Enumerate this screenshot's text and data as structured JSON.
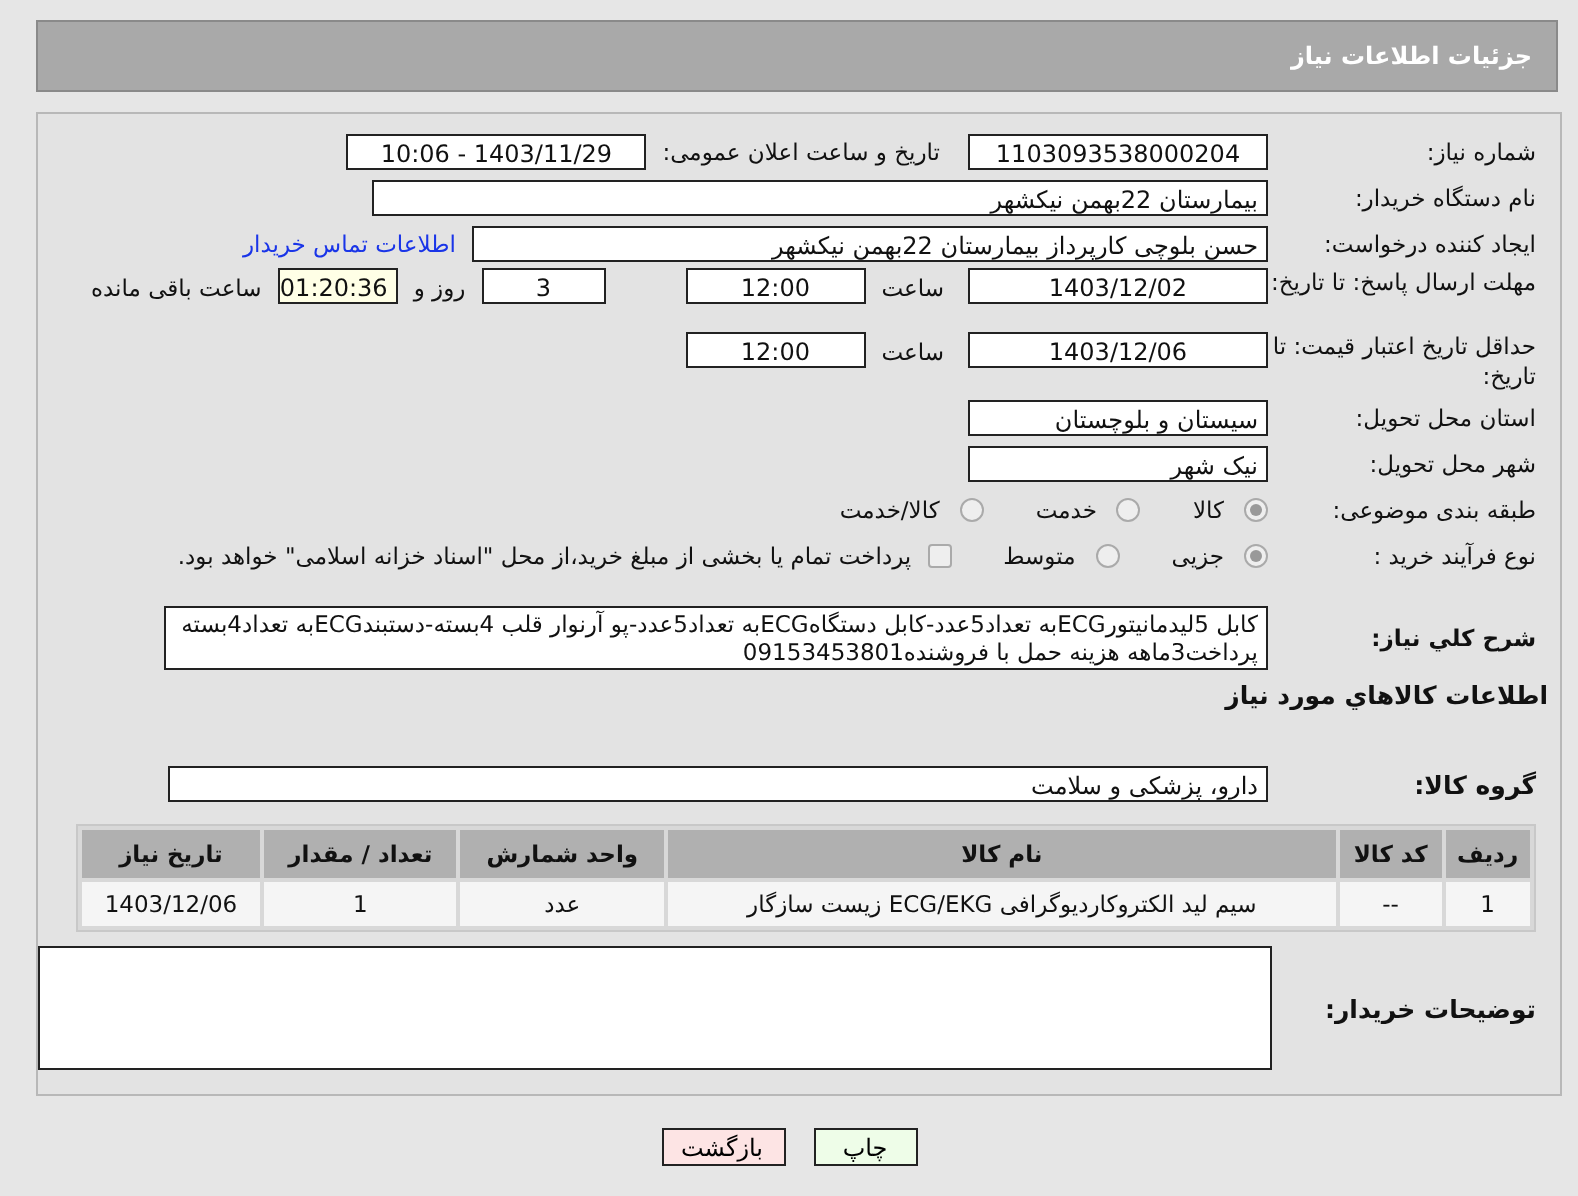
{
  "header": {
    "title": "جزئیات اطلاعات نیاز"
  },
  "need_number": {
    "label": "شماره نیاز:",
    "value": "1103093538000204"
  },
  "announce_date": {
    "label": "تاریخ و ساعت اعلان عمومی:",
    "value": "1403/11/29 - 10:06"
  },
  "buyer_org": {
    "label": "نام دستگاه خریدار:",
    "value": "بیمارستان 22بهمن نیکشهر"
  },
  "requester": {
    "label": "ایجاد کننده درخواست:",
    "value": "حسن بلوچی کارپرداز  بیمارستان 22بهمن نیکشهر",
    "link": "اطلاعات تماس خریدار"
  },
  "reply_deadline": {
    "label": "مهلت ارسال پاسخ: تا تاریخ:",
    "date": "1403/12/02",
    "time_label": "ساعت",
    "time": "12:00",
    "days": "3",
    "days_label": "روز و",
    "remaining": "01:20:36",
    "remaining_label": "ساعت باقی مانده"
  },
  "price_validity": {
    "label": "حداقل تاریخ اعتبار قیمت: تا تاریخ:",
    "date": "1403/12/06",
    "time_label": "ساعت",
    "time": "12:00"
  },
  "province": {
    "label": "استان محل تحویل:",
    "value": "سیستان و بلوچستان"
  },
  "city": {
    "label": "شهر محل تحویل:",
    "value": "نیک شهر"
  },
  "category": {
    "label": "طبقه بندی موضوعی:",
    "options": [
      {
        "label": "كالا",
        "selected": true
      },
      {
        "label": "خدمت",
        "selected": false
      },
      {
        "label": "كالا/خدمت",
        "selected": false
      }
    ]
  },
  "purchase_type": {
    "label": "نوع فرآیند خرید :",
    "options": [
      {
        "label": "جزیی",
        "selected": true
      },
      {
        "label": "متوسط",
        "selected": false
      }
    ],
    "payment_checkbox": {
      "label": "پرداخت تمام یا بخشی از مبلغ خرید،از محل \"اسناد خزانه اسلامی\" خواهد بود.",
      "checked": false
    }
  },
  "description": {
    "label": "شرح كلي نياز:",
    "value": "کابل 5لیدمانیتورECGبه تعداد5عدد-کابل دستگاهECGبه تعداد5عدد-پو آرنوار قلب 4بسته-دستبندECGبه تعداد4بسته پرداخت3ماهه هزینه حمل با فروشنده09153453801"
  },
  "goods_heading": "اطلاعات كالاهاي مورد نياز",
  "goods_group": {
    "label": "گروه كالا:",
    "value": "دارو، پزشکی و سلامت"
  },
  "table": {
    "columns": [
      "ردیف",
      "کد کالا",
      "نام کالا",
      "واحد شمارش",
      "تعداد / مقدار",
      "تاریخ نیاز"
    ],
    "rows": [
      [
        "1",
        "--",
        "سیم لید الکتروکاردیوگرافی ECG/EKG زیست سازگار",
        "عدد",
        "1",
        "1403/12/06"
      ]
    ]
  },
  "buyer_notes": {
    "label": "توضیحات خریدار:"
  },
  "buttons": [
    {
      "kind": "print",
      "label": "چاپ"
    },
    {
      "kind": "back",
      "label": "بازگشت"
    }
  ]
}
